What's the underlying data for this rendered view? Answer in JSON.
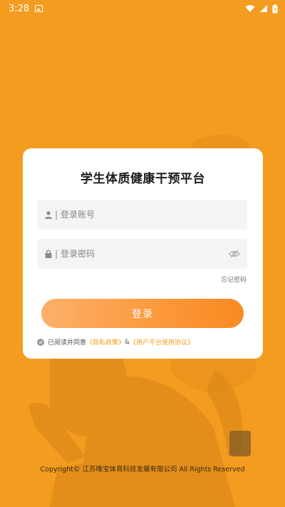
{
  "status_bar": {
    "time": "3:28"
  },
  "card": {
    "title": "学生体质健康干预平台",
    "account_placeholder": "登录账号",
    "password_placeholder": "登录密码",
    "separator": "|",
    "forgot_label": "忘记密码",
    "login_label": "登录",
    "agreement": {
      "prefix": "已阅读并同意",
      "privacy_link": "《隐私政策》",
      "amp": "&",
      "terms_link": "《用户平台使用协议》"
    }
  },
  "footer": {
    "copyright": "Copyright© 江苏唯宝体育科技发展有限公司 All Rights Reserved"
  },
  "colors": {
    "background": "#F39C1F",
    "accent": "#F39C1F",
    "button_gradient_end": "#F98A22"
  },
  "icons": [
    "image-icon",
    "wifi-icon",
    "signal-icon",
    "battery-icon",
    "user-icon",
    "lock-icon",
    "eye-off-icon",
    "check-circle-icon"
  ]
}
